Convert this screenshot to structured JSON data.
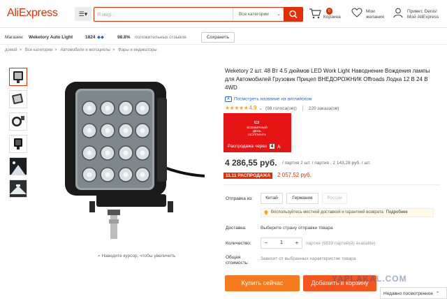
{
  "header": {
    "logo": "AliExpress",
    "menu_icon": "hamburger-icon",
    "search_placeholder": "Я ищу...",
    "category_select": "Все категории",
    "cart_count": "0",
    "cart_label": "Корзина",
    "wishlist_line1": "Мои",
    "wishlist_line2": "желания",
    "greeting": "Привет, Denis!",
    "my_account": "Мой AliExpress",
    "brand_color": "#e62e04"
  },
  "store": {
    "label": "Магазин:",
    "name": "Weketory Auto Light",
    "score": "1824",
    "positive_pct": "98.8%",
    "positive_label": "положительных отзывов",
    "save_label": "Сохранить"
  },
  "breadcrumb": [
    "домой",
    "Все категории",
    "Автомобили и мотоциклы",
    "Фары и индикаторы"
  ],
  "product": {
    "title": "Weketory 2 шт. 48 Вт 4.5 дюймов LED Work Light Наводнение Вождения лампы для Автомобилей Грузовик Прицеп ВНЕДОРОЖНИК Offroads Лодка 12 В 24 В 4WD",
    "translate_link": "Посмотреть название на английском",
    "rating": "4.9",
    "votes": "(98 голоса(ов))",
    "orders": "220 заказа(ов)",
    "promo_line1": "ВСЕМИРНЫЙ ДЕНЬ",
    "promo_line2": "ШОППИНГА",
    "promo_text": "Распродажа через",
    "promo_days_num": "4",
    "promo_days_unit": "д.",
    "price": "4 286,55 руб.",
    "price_sub": "/ партия 2 шт. / партия , 2 143,28 руб. / шт.",
    "sale_badge": "11.11 РАСПРОДАЖА",
    "sale_price": "2 057,52 руб.",
    "zoom_hint": "Наведите курсор, чтобы увеличить"
  },
  "options": {
    "ship_from_label": "Отправка из:",
    "countries": [
      "Китай",
      "Германия",
      "Россия"
    ],
    "notice": "Воспользуйтесь местной доставкой и гарантией возврата",
    "notice_more": "Подробнее",
    "delivery_label": "Доставка:",
    "delivery_value": "Выберите страну отправки товара",
    "qty_label": "Количество:",
    "qty_value": "1",
    "qty_minus": "−",
    "qty_plus": "+",
    "qty_avail": "партия (9839 партий(й) available)",
    "total_label_1": "Общая",
    "total_label_2": "стоимость:",
    "total_value": "Зависит от выбранных характеристик товара"
  },
  "actions": {
    "buy_now": "Купить сейчас",
    "add_to_cart": "Добавить в корзину"
  },
  "watermark": "YAPLAKAL.COM",
  "recently_viewed": "Недавно посмотренное"
}
